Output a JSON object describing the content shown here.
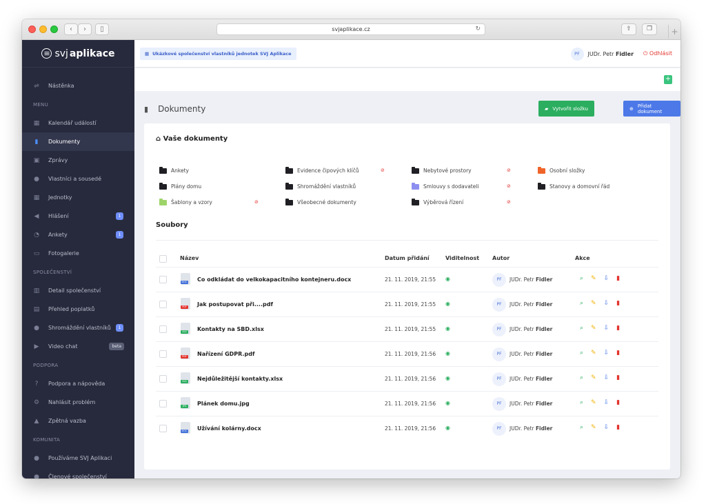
{
  "browser": {
    "url": "svjaplikace.cz",
    "reload_glyph": "↻",
    "back_glyph": "‹",
    "forward_glyph": "›",
    "sidebar_glyph": "▯",
    "share_glyph": "⇧",
    "tabs_glyph": "❐",
    "newtab_glyph": "+"
  },
  "logo": {
    "glyph": "≡",
    "text_light": "svj",
    "text_bold": "aplikace"
  },
  "sidebar": {
    "dashboard": {
      "icon": "signpost-icon",
      "glyph": "⇌",
      "label": "Nástěnka"
    },
    "sections": [
      {
        "title": "MENU",
        "items": [
          {
            "icon": "calendar-icon",
            "glyph": "▦",
            "label": "Kalendář událostí"
          },
          {
            "icon": "document-icon",
            "glyph": "▮",
            "label": "Dokumenty",
            "active": true
          },
          {
            "icon": "message-icon",
            "glyph": "▣",
            "label": "Zprávy"
          },
          {
            "icon": "users-icon",
            "glyph": "●",
            "label": "Vlastníci a sousedé"
          },
          {
            "icon": "grid-icon",
            "glyph": "▦",
            "label": "Jednotky"
          },
          {
            "icon": "megaphone-icon",
            "glyph": "◀",
            "label": "Hlášení",
            "badge": "1"
          },
          {
            "icon": "chart-icon",
            "glyph": "◔",
            "label": "Ankety",
            "badge": "1"
          },
          {
            "icon": "image-icon",
            "glyph": "▭",
            "label": "Fotogalerie"
          }
        ]
      },
      {
        "title": "SPOLEČENSTVÍ",
        "items": [
          {
            "icon": "building-icon",
            "glyph": "▥",
            "label": "Detail společenství"
          },
          {
            "icon": "money-icon",
            "glyph": "▤",
            "label": "Přehled poplatků"
          },
          {
            "icon": "meeting-icon",
            "glyph": "●",
            "label": "Shromáždění vlastníků",
            "badge": "1"
          },
          {
            "icon": "video-icon",
            "glyph": "▶",
            "label": "Video chat",
            "beta": "beta"
          }
        ]
      },
      {
        "title": "PODPORA",
        "items": [
          {
            "icon": "question-icon",
            "glyph": "?",
            "label": "Podpora a nápověda"
          },
          {
            "icon": "settings-icon",
            "glyph": "⚙",
            "label": "Nahlásit problém"
          },
          {
            "icon": "thumbs-up-icon",
            "glyph": "▲",
            "label": "Zpětná vazba"
          }
        ]
      },
      {
        "title": "KOMUNITA",
        "items": [
          {
            "icon": "chat-icon",
            "glyph": "●",
            "label": "Používáme SVJ Aplikaci"
          },
          {
            "icon": "members-icon",
            "glyph": "●",
            "label": "Členové společenství"
          }
        ]
      }
    ]
  },
  "topbar": {
    "association_glyph": "▦",
    "association": "Ukázkové společenství vlastníků jednotek SVJ Aplikace",
    "user_initials": "PF",
    "user_name_prefix": "JUDr. Petr",
    "user_name_bold": "Fidler",
    "logout_glyph": "⏻",
    "logout_label": "Odhlásit",
    "add_glyph": "+"
  },
  "page": {
    "title": "Dokumenty",
    "title_glyph": "▮",
    "create_folder_label": "Vytvořit složku",
    "create_folder_glyph": "▰",
    "add_document_label": "Přidat dokument",
    "add_document_glyph": "⊕",
    "your_documents_title": "Vaše dokumenty",
    "your_documents_glyph": "⌂",
    "files_title": "Soubory"
  },
  "colors": {
    "folder_black": "#1f1f24",
    "folder_purple": "#8d8ff0",
    "folder_green": "#9ed36a",
    "folder_orange": "#f0642a"
  },
  "folders": [
    {
      "name": "Ankety",
      "color": "#1f1f24",
      "hidden": false
    },
    {
      "name": "Evidence čipových klíčů",
      "color": "#1f1f24",
      "hidden": true
    },
    {
      "name": "Nebytové prostory",
      "color": "#1f1f24",
      "hidden": true
    },
    {
      "name": "Osobní složky",
      "color": "#f0642a",
      "hidden": false
    },
    {
      "name": "Plány domu",
      "color": "#1f1f24",
      "hidden": false
    },
    {
      "name": "Shromáždění vlastníků",
      "color": "#1f1f24",
      "hidden": false
    },
    {
      "name": "Smlouvy s dodavateli",
      "color": "#8d8ff0",
      "hidden": true
    },
    {
      "name": "Stanovy a domovní řád",
      "color": "#1f1f24",
      "hidden": false
    },
    {
      "name": "Šablony a vzory",
      "color": "#9ed36a",
      "hidden": true
    },
    {
      "name": "Všeobecné dokumenty",
      "color": "#1f1f24",
      "hidden": false
    },
    {
      "name": "Výběrová řízení",
      "color": "#1f1f24",
      "hidden": true
    }
  ],
  "folder_hidden_glyph": "⊘",
  "table": {
    "headers": {
      "name": "Název",
      "date": "Datum přidání",
      "visibility": "Viditelnost",
      "author": "Autor",
      "actions": "Akce"
    },
    "eye_glyph": "◉",
    "action_glyphs": {
      "view": "⌕",
      "edit": "✎",
      "download": "⇩",
      "delete": "▮"
    },
    "rows": [
      {
        "name": "Co odkládat do velkokapacitního kontejneru.docx",
        "type": "DOC",
        "type_color": "#3f6fd8",
        "date": "21. 11. 2019, 21:55",
        "author_initials": "PF",
        "author_prefix": "JUDr. Petr",
        "author_bold": "Fidler"
      },
      {
        "name": "Jak postupovat při....pdf",
        "type": "PDF",
        "type_color": "#e3342f",
        "date": "21. 11. 2019, 21:55",
        "author_initials": "PF",
        "author_prefix": "JUDr. Petr",
        "author_bold": "Fidler"
      },
      {
        "name": "Kontakty na SBD.xlsx",
        "type": "XLS",
        "type_color": "#2bae5f",
        "date": "21. 11. 2019, 21:55",
        "author_initials": "PF",
        "author_prefix": "JUDr. Petr",
        "author_bold": "Fidler"
      },
      {
        "name": "Nařízení GDPR.pdf",
        "type": "PDF",
        "type_color": "#e3342f",
        "date": "21. 11. 2019, 21:56",
        "author_initials": "PF",
        "author_prefix": "JUDr. Petr",
        "author_bold": "Fidler"
      },
      {
        "name": "Nejdůležitější kontakty.xlsx",
        "type": "XLS",
        "type_color": "#2bae5f",
        "date": "21. 11. 2019, 21:56",
        "author_initials": "PF",
        "author_prefix": "JUDr. Petr",
        "author_bold": "Fidler"
      },
      {
        "name": "Plánek domu.jpg",
        "type": "JPG",
        "type_color": "#2bae5f",
        "date": "21. 11. 2019, 21:56",
        "author_initials": "PF",
        "author_prefix": "JUDr. Petr",
        "author_bold": "Fidler"
      },
      {
        "name": "Užívání kolárny.docx",
        "type": "DOC",
        "type_color": "#3f6fd8",
        "date": "21. 11. 2019, 21:56",
        "author_initials": "PF",
        "author_prefix": "JUDr. Petr",
        "author_bold": "Fidler"
      }
    ]
  }
}
